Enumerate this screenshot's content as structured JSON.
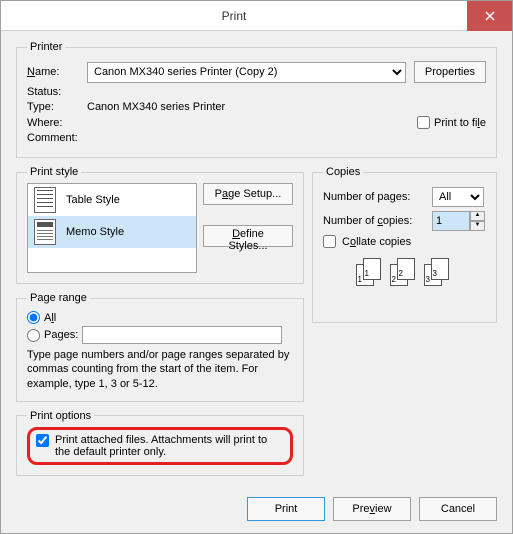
{
  "window": {
    "title": "Print"
  },
  "printer": {
    "legend": "Printer",
    "name_label": "Name:",
    "name_value": "Canon MX340 series Printer (Copy 2)",
    "properties_btn": "Properties",
    "status_label": "Status:",
    "status_value": "",
    "type_label": "Type:",
    "type_value": "Canon MX340 series Printer",
    "where_label": "Where:",
    "where_value": "",
    "comment_label": "Comment:",
    "comment_value": "",
    "print_to_file_label": "Print to file"
  },
  "print_style": {
    "legend": "Print style",
    "items": [
      {
        "label": "Table Style"
      },
      {
        "label": "Memo Style"
      }
    ],
    "page_setup_btn": "Page Setup...",
    "define_styles_btn": "Define Styles..."
  },
  "copies": {
    "legend": "Copies",
    "num_pages_label": "Number of pages:",
    "num_pages_value": "All",
    "num_copies_label": "Number of copies:",
    "num_copies_value": "1",
    "collate_label": "Collate copies"
  },
  "page_range": {
    "legend": "Page range",
    "all_label": "All",
    "pages_label": "Pages:",
    "pages_value": "",
    "hint": "Type page numbers and/or page ranges separated by commas counting from the start of the item.  For example, type 1, 3 or 5-12."
  },
  "print_options": {
    "legend": "Print options",
    "attached_label": "Print attached files.  Attachments will print to the default printer only."
  },
  "buttons": {
    "print": "Print",
    "preview": "Preview",
    "cancel": "Cancel"
  }
}
